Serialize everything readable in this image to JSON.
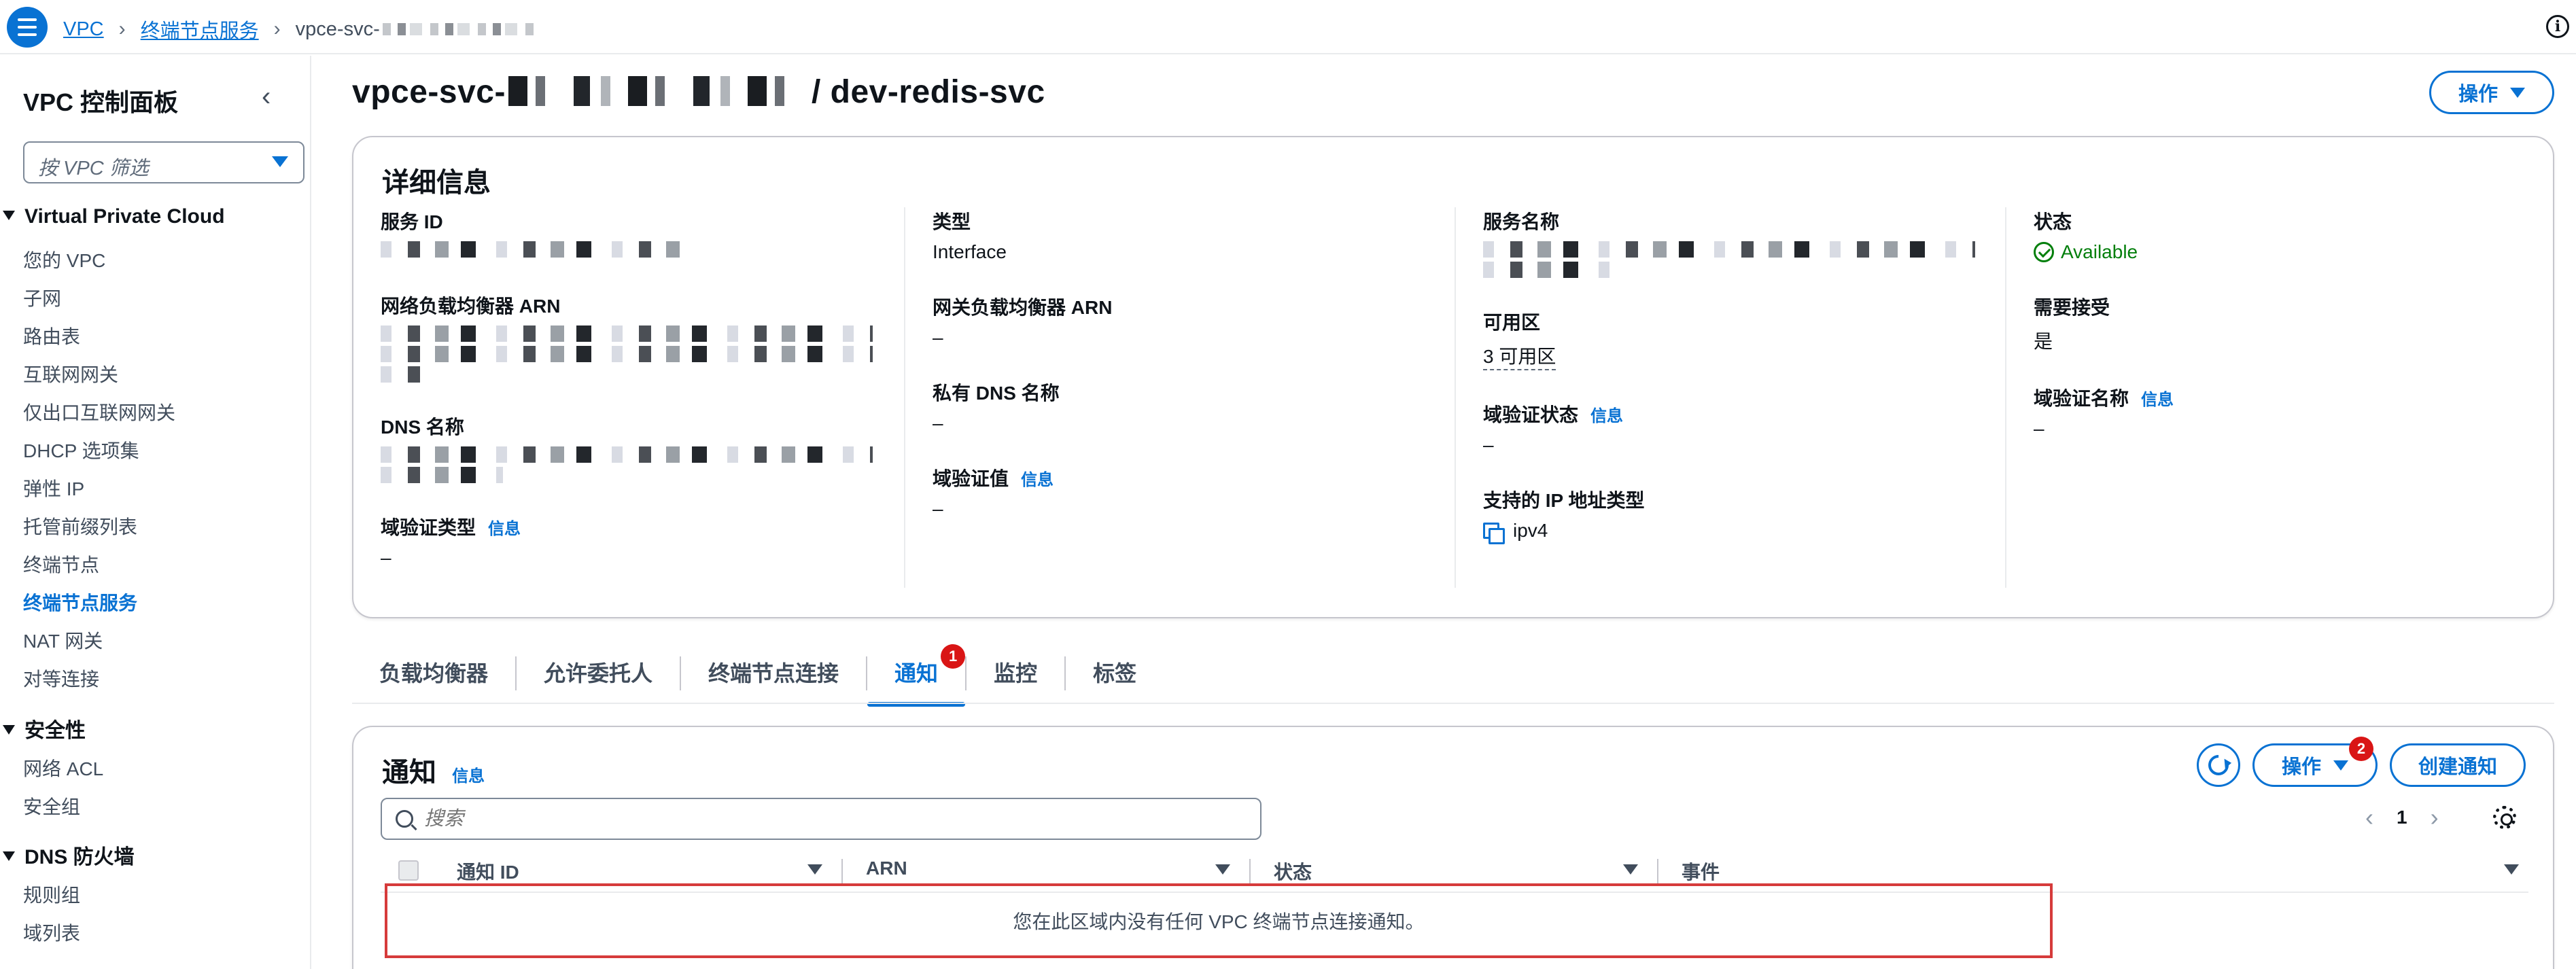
{
  "breadcrumb": {
    "vpc": "VPC",
    "endpoint_services": "终端节点服务",
    "current": "vpce-svc-"
  },
  "sidebar": {
    "title": "VPC 控制面板",
    "filter_placeholder": "按 VPC 筛选",
    "sections": [
      {
        "title": "Virtual Private Cloud",
        "items": [
          "您的 VPC",
          "子网",
          "路由表",
          "互联网网关",
          "仅出口互联网网关",
          "DHCP 选项集",
          "弹性 IP",
          "托管前缀列表",
          "终端节点",
          "终端节点服务",
          "NAT 网关",
          "对等连接"
        ]
      },
      {
        "title": "安全性",
        "items": [
          "网络 ACL",
          "安全组"
        ]
      },
      {
        "title": "DNS 防火墙",
        "items": [
          "规则组",
          "域列表"
        ]
      }
    ],
    "active_item": "终端节点服务"
  },
  "page": {
    "title_prefix": "vpce-svc-",
    "title_suffix": "/ dev-redis-svc",
    "actions_label": "操作"
  },
  "details": {
    "title": "详细信息",
    "service_id_label": "服务 ID",
    "nlb_arn_label": "网络负载均衡器 ARN",
    "dns_name_label": "DNS 名称",
    "domain_verif_type_label": "域验证类型",
    "domain_verif_type_value": "–",
    "type_label": "类型",
    "type_value": "Interface",
    "gwlb_arn_label": "网关负载均衡器 ARN",
    "gwlb_arn_value": "–",
    "private_dns_label": "私有 DNS 名称",
    "private_dns_value": "–",
    "domain_verif_value_label": "域验证值",
    "domain_verif_value_value": "–",
    "service_name_label": "服务名称",
    "az_label": "可用区",
    "az_value": "3 可用区",
    "domain_verif_status_label": "域验证状态",
    "domain_verif_status_value": "–",
    "ip_types_label": "支持的 IP 地址类型",
    "ip_types_value": "ipv4",
    "state_label": "状态",
    "state_value": "Available",
    "acceptance_label": "需要接受",
    "acceptance_value": "是",
    "domain_verif_name_label": "域验证名称",
    "domain_verif_name_value": "–",
    "info_link": "信息"
  },
  "tabs": {
    "items": [
      "负载均衡器",
      "允许委托人",
      "终端节点连接",
      "通知",
      "监控",
      "标签"
    ],
    "active": "通知",
    "notif_badge": "1"
  },
  "notifications": {
    "title": "通知",
    "info_link": "信息",
    "actions_label": "操作",
    "actions_badge": "2",
    "create_label": "创建通知",
    "search_placeholder": "搜索",
    "page_number": "1",
    "columns": [
      "通知 ID",
      "ARN",
      "状态",
      "事件"
    ],
    "empty_message": "您在此区域内没有任何 VPC 终端节点连接通知。"
  },
  "colors": {
    "accent": "#0972d3",
    "success": "#037f0c",
    "badge": "#d91515",
    "highlight_border": "#d63b3b"
  }
}
